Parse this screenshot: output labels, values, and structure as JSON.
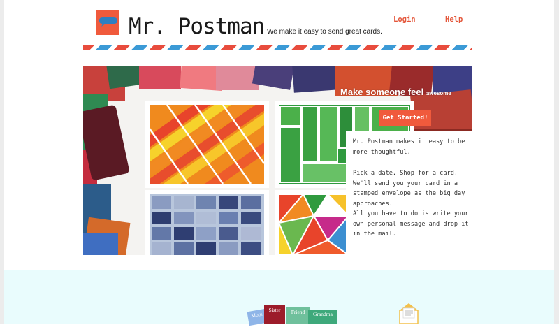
{
  "brand": {
    "name": "Mr. Postman",
    "tagline": "We make it easy to send great cards.",
    "colors": {
      "accent": "#f05a3c",
      "stripe_red": "#e84c3d",
      "stripe_blue": "#3b9ad6",
      "lower_bg": "#e9fcfd"
    }
  },
  "nav": {
    "login": "Login",
    "help": "Help"
  },
  "hero": {
    "headline": "Make someone feel",
    "headline_small": "awesome",
    "cta_label": "Get Started!",
    "intro": "Mr. Postman makes it easy to be more thoughtful.",
    "body": "Pick a date. Shop for a card. We'll send you your card in a stamped envelope as the big day approaches.",
    "body2": "All you have to do is write your own personal message and drop it in the mail."
  },
  "categories": [
    "Mom",
    "Sister",
    "Friend",
    "Grandma"
  ],
  "icons": {
    "logo": "speech-bubble-icon",
    "envelope": "envelope-icon"
  }
}
